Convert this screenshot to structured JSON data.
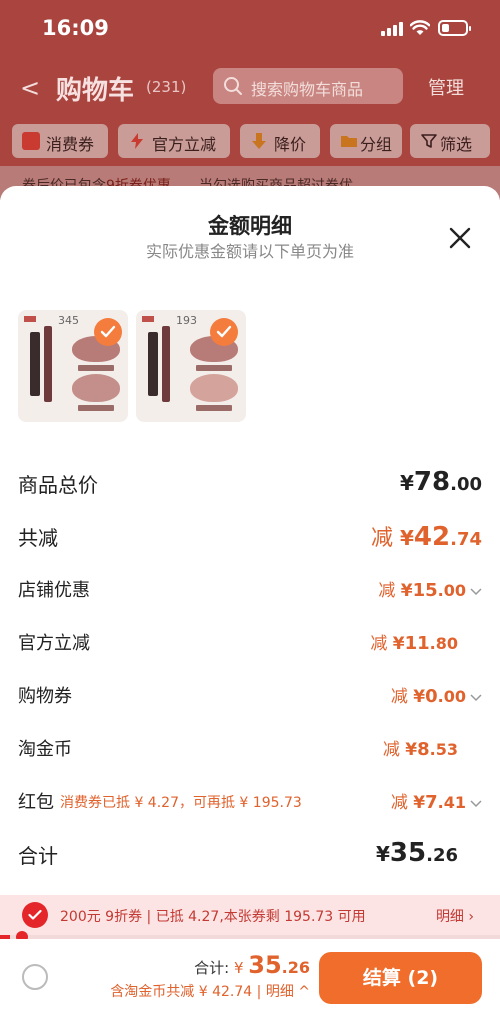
{
  "status_bar": {
    "time": "16:09"
  },
  "header": {
    "title": "购物车",
    "count": "(231)",
    "search_placeholder": "搜索购物车商品",
    "manage": "管理"
  },
  "filters": [
    {
      "label": "消费券",
      "icon": "coupon-icon"
    },
    {
      "label": "官方立减",
      "icon": "lightning-icon"
    },
    {
      "label": "降价",
      "icon": "down-arrow-icon"
    },
    {
      "label": "分组",
      "icon": "folder-icon"
    },
    {
      "label": "筛选",
      "icon": "funnel-icon"
    }
  ],
  "promo_banner": {
    "part1": "券后价已包含",
    "part2": "9折券优惠",
    "part3": "，当勾选购买商品超过券优"
  },
  "sheet": {
    "title": "金额明细",
    "subtitle": "实际优惠金额请以下单页为准",
    "products": [
      {
        "sold": "345",
        "selected": true
      },
      {
        "sold": "193",
        "selected": true
      }
    ],
    "rows": {
      "total": {
        "label": "商品总价",
        "yen": "¥",
        "int": "78",
        "dec": ".00"
      },
      "reduce": {
        "label": "共减",
        "prefix": "减 ",
        "yen": "¥",
        "int": "42",
        "dec": ".74"
      },
      "store": {
        "label": "店铺优惠",
        "prefix": "减 ",
        "yen": "¥",
        "int": "15",
        "dec": ".00"
      },
      "official": {
        "label": "官方立减",
        "prefix": "减 ",
        "yen": "¥",
        "int": "11",
        "dec": ".80"
      },
      "voucher": {
        "label": "购物券",
        "prefix": "减 ",
        "yen": "¥",
        "int": "0",
        "dec": ".00"
      },
      "gold": {
        "label": "淘金币",
        "prefix": "减 ",
        "yen": "¥",
        "int": "8",
        "dec": ".53"
      },
      "redpacket": {
        "label": "红包",
        "hint": "消费券已抵 ¥ 4.27，可再抵 ¥ 195.73",
        "prefix": "减 ",
        "yen": "¥",
        "int": "7",
        "dec": ".41"
      },
      "sum": {
        "label": "合计",
        "yen": "¥",
        "int": "35",
        "dec": ".26"
      }
    }
  },
  "coupon_strip": {
    "text": "200元 9折券 | 已抵 4.27,本张券剩 195.73 可用",
    "detail": "明细 ›",
    "progress": 0.02
  },
  "bottom_bar": {
    "total_label": "合计: ",
    "currency": "¥ ",
    "amount_int": "35",
    "amount_dec": ".26",
    "sub_text": "含淘金币共减 ¥ 42.74 | 明细 ^",
    "checkout": "结算 (2)"
  },
  "colors": {
    "accent": "#e0622d",
    "checkout": "#f06d2b",
    "coupon_red": "#e4262a",
    "header_bg": "#a9443f"
  }
}
